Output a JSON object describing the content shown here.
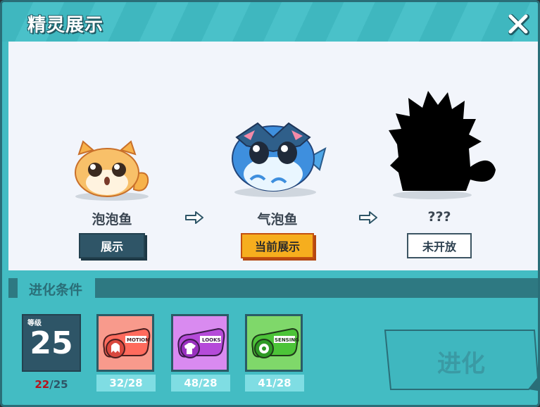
{
  "title": "精灵展示",
  "stages": [
    {
      "name": "泡泡鱼",
      "button": "展示"
    },
    {
      "name": "气泡鱼",
      "button": "当前展示"
    },
    {
      "name": "???",
      "button": "未开放"
    }
  ],
  "conditions": {
    "title": "进化条件",
    "level": {
      "label": "等级",
      "value": "25",
      "current": "22",
      "sep": "/",
      "required": "25"
    },
    "items": [
      {
        "icon": "motion-extension-icon",
        "text": "MOTION",
        "count": "32/28"
      },
      {
        "icon": "looks-extension-icon",
        "text": "LOOKS",
        "count": "48/28"
      },
      {
        "icon": "sensing-extension-icon",
        "text": "SENSING",
        "count": "41/28"
      }
    ]
  },
  "evolve_label": "进化",
  "colors": {
    "teal": "#43bcc3",
    "dark_teal": "#2a6e78",
    "orange": "#f6ae1e"
  }
}
